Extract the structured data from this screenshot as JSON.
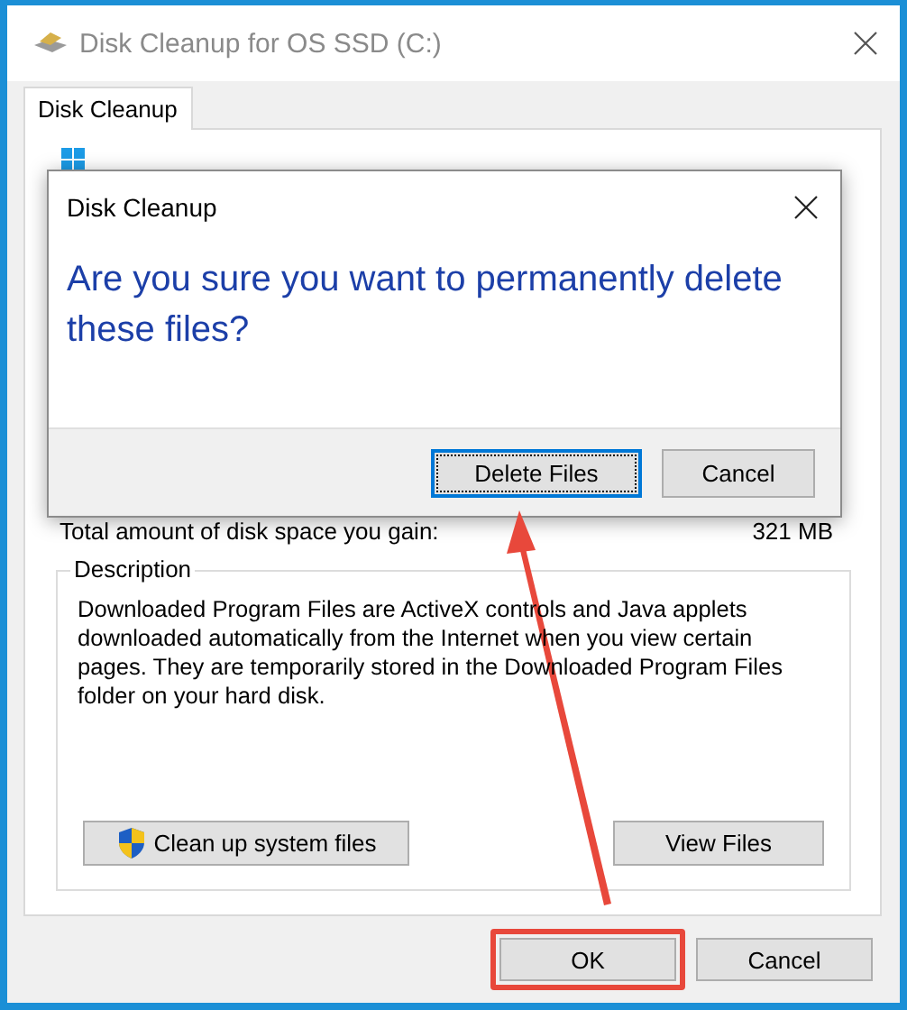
{
  "window": {
    "title": "Disk Cleanup for OS SSD (C:)"
  },
  "tabs": [
    {
      "label": "Disk Cleanup",
      "selected": true
    }
  ],
  "summary": {
    "label": "Total amount of disk space you gain:",
    "value": "321 MB"
  },
  "description": {
    "legend": "Description",
    "text": "Downloaded Program Files are ActiveX controls and Java applets downloaded automatically from the Internet when you view certain pages. They are temporarily stored in the Downloaded Program Files folder on your hard disk."
  },
  "panel_buttons": [
    {
      "label": "Clean up system files",
      "kind": "shield"
    },
    {
      "label": "View Files",
      "kind": "plain"
    }
  ],
  "buttons": [
    {
      "label": "OK",
      "highlighted": true
    },
    {
      "label": "Cancel",
      "highlighted": false
    }
  ],
  "dialog": {
    "title": "Disk Cleanup",
    "message": "Are you sure you want to permanently delete these files?",
    "buttons": [
      {
        "label": "Delete Files",
        "focused": true
      },
      {
        "label": "Cancel",
        "focused": false
      }
    ]
  }
}
